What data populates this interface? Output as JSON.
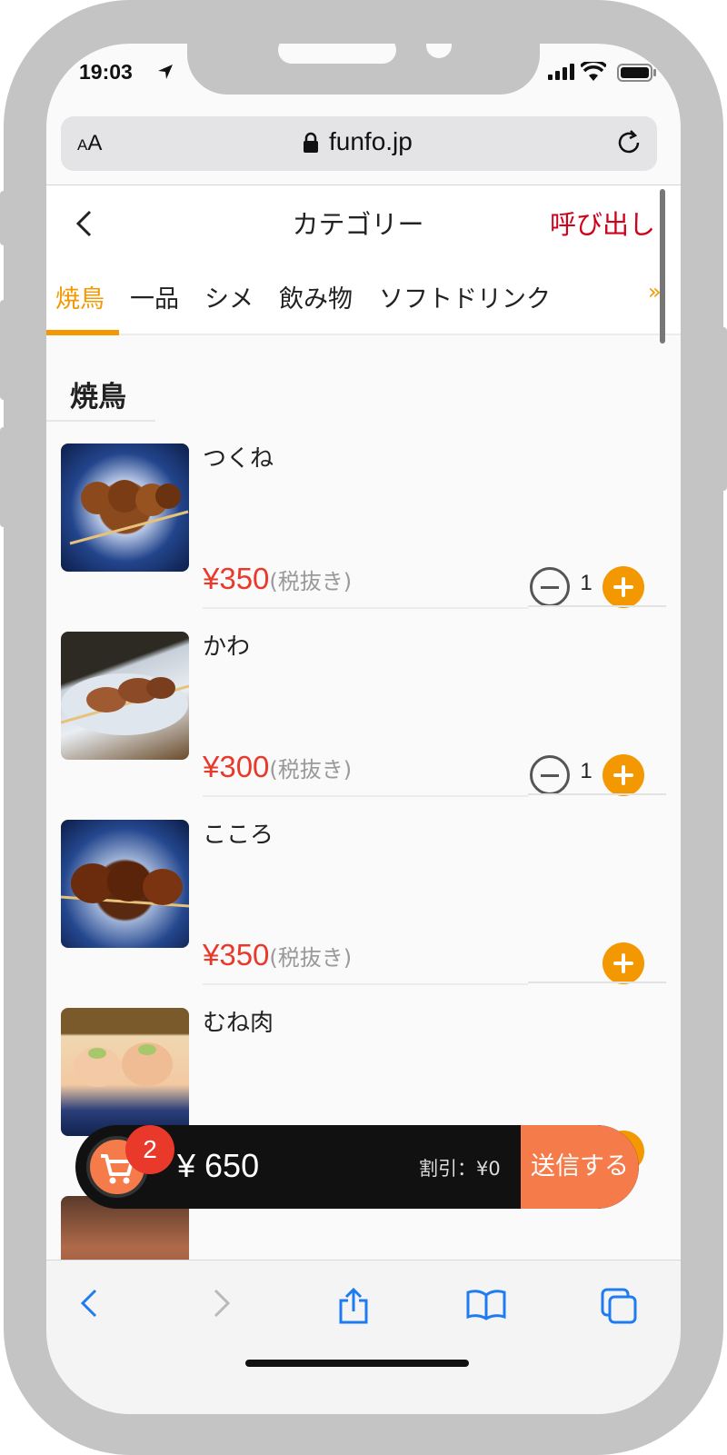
{
  "status_bar": {
    "time": "19:03"
  },
  "browser": {
    "text_size_label": "AA",
    "domain": "funfo.jp"
  },
  "header": {
    "title": "カテゴリー",
    "call_label": "呼び出し"
  },
  "tabs": [
    "焼鳥",
    "一品",
    "シメ",
    "飲み物",
    "ソフトドリンク"
  ],
  "tabs_more": "»",
  "section": {
    "title": "焼鳥"
  },
  "items": [
    {
      "name": "つくね",
      "price": "¥350",
      "tax_note": "(税抜き)",
      "quantity": "1"
    },
    {
      "name": "かわ",
      "price": "¥300",
      "tax_note": "(税抜き)",
      "quantity": "1"
    },
    {
      "name": "こころ",
      "price": "¥350",
      "tax_note": "(税抜き)",
      "quantity": ""
    },
    {
      "name": "むね肉",
      "price": "",
      "tax_note": "",
      "quantity": ""
    }
  ],
  "cart": {
    "count": "2",
    "total": "¥ 650",
    "discount": "割引：¥0",
    "send_label": "送信する"
  },
  "colors": {
    "accent": "#f39800",
    "price": "#e8392b",
    "call": "#d0021b",
    "send": "#f57b4a"
  }
}
